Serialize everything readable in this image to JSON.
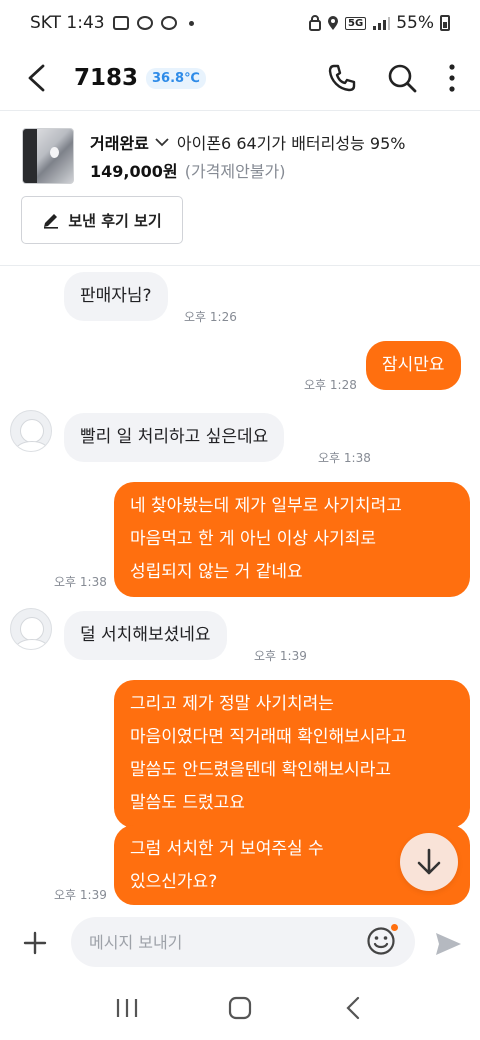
{
  "status_bar": {
    "carrier_time": "SKT 1:43",
    "network": "5G",
    "battery": "55%"
  },
  "header": {
    "title": "7183",
    "temperature": "36.8℃"
  },
  "product": {
    "status": "거래완료",
    "title": "아이폰6 64기가 배터리성능 95%",
    "price": "149,000원",
    "price_note": "(가격제안불가)",
    "review_button": "보낸 후기 보기"
  },
  "messages": [
    {
      "from": "them",
      "text": "판매자님?",
      "time": "오후 1:26"
    },
    {
      "from": "me",
      "text": "잠시만요",
      "time": "오후 1:28"
    },
    {
      "from": "them",
      "text": "빨리 일 처리하고 싶은데요",
      "time": "오후 1:38"
    },
    {
      "from": "me",
      "lines": [
        "네 찾아봤는데 제가 일부로 사기치려고",
        "마음먹고 한 게 아닌 이상 사기죄로",
        "성립되지 않는 거 같네요"
      ],
      "time": "오후 1:38"
    },
    {
      "from": "them",
      "text": "덜 서치해보셨네요",
      "time": "오후 1:39"
    },
    {
      "from": "me",
      "lines": [
        "그리고 제가 정말 사기치려는",
        "마음이였다면 직거래때 확인해보시라고",
        "말씀도 안드렸을텐데 확인해보시라고",
        "말씀도 드렸고요"
      ]
    },
    {
      "from": "me",
      "lines": [
        "그럼 서치한 거 보여주실 수",
        "있으신가요?"
      ],
      "time": "오후 1:39"
    }
  ],
  "input": {
    "placeholder": "메시지 보내기"
  },
  "colors": {
    "accent": "#ff6f0f",
    "incoming_bubble": "#f2f3f6",
    "temperature": "#2e8be8"
  }
}
